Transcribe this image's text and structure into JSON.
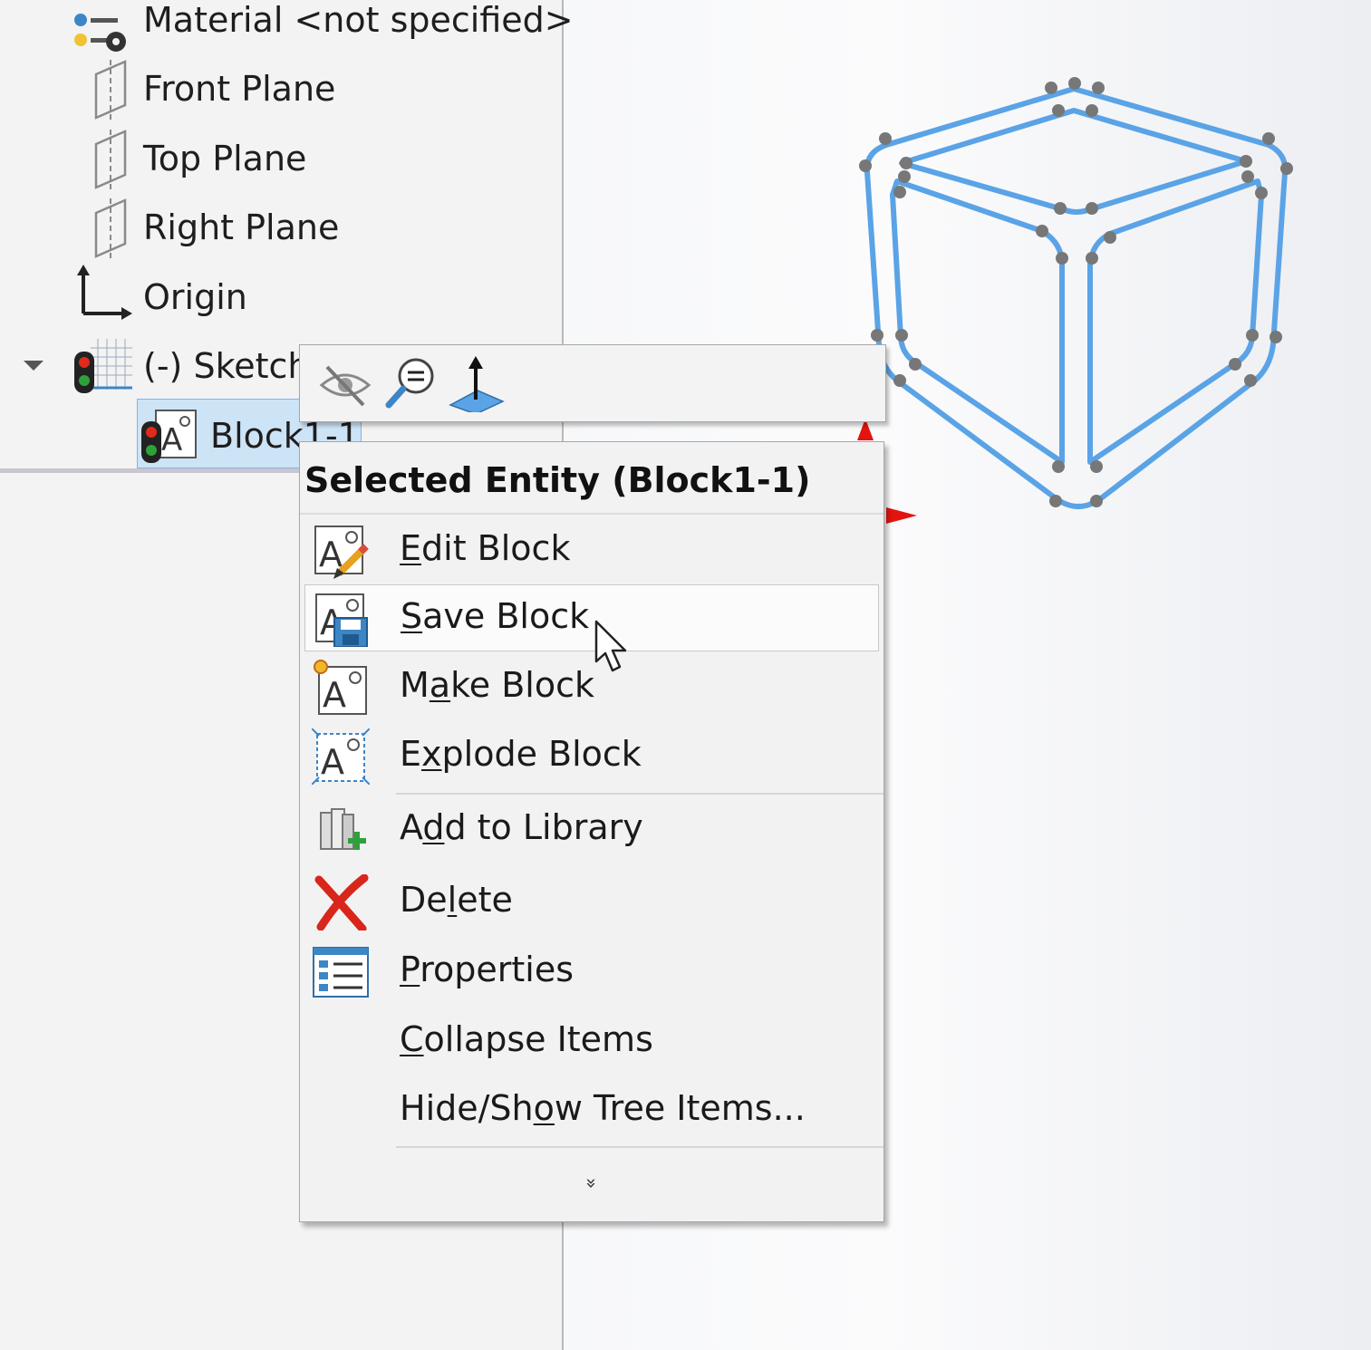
{
  "tree": {
    "items": [
      {
        "label": "Material <not specified>",
        "icon": "material-icon"
      },
      {
        "label": "Front Plane",
        "icon": "plane-icon"
      },
      {
        "label": "Top Plane",
        "icon": "plane-icon"
      },
      {
        "label": "Right Plane",
        "icon": "plane-icon"
      },
      {
        "label": "Origin",
        "icon": "origin-icon"
      },
      {
        "label": "(-) Sketch",
        "icon": "sketch-icon"
      },
      {
        "label": "Block1-1",
        "icon": "block-icon",
        "selected": true
      }
    ]
  },
  "context_toolbar": {
    "buttons": [
      {
        "name": "hide",
        "icon": "eye-hidden-icon"
      },
      {
        "name": "zoom-to-selection",
        "icon": "zoom-selection-icon"
      },
      {
        "name": "normal-to",
        "icon": "normal-to-icon"
      }
    ]
  },
  "context_menu": {
    "header": "Selected Entity (Block1-1)",
    "items": [
      {
        "pre": "",
        "accel": "E",
        "post": "dit Block",
        "icon": "edit-block-icon"
      },
      {
        "pre": "",
        "accel": "S",
        "post": "ave Block",
        "icon": "save-block-icon",
        "hover": true
      },
      {
        "pre": "M",
        "accel": "a",
        "post": "ke Block",
        "icon": "make-block-icon"
      },
      {
        "pre": "E",
        "accel": "x",
        "post": "plode Block",
        "icon": "explode-block-icon"
      },
      {
        "pre": "A",
        "accel": "d",
        "post": "d to Library",
        "icon": "add-library-icon"
      },
      {
        "pre": "De",
        "accel": "l",
        "post": "ete",
        "icon": "delete-icon"
      },
      {
        "pre": "",
        "accel": "P",
        "post": "roperties",
        "icon": "properties-icon"
      },
      {
        "pre": "",
        "accel": "C",
        "post": "ollapse Items",
        "icon": ""
      },
      {
        "pre": "Hide/Sh",
        "accel": "o",
        "post": "w Tree Items...",
        "icon": ""
      }
    ],
    "more_glyph": "»"
  },
  "colors": {
    "selection": "#cde4f7",
    "sketch_line": "#5aa3e6",
    "delete_red": "#d8261b",
    "axis_red": "#e3140f"
  }
}
